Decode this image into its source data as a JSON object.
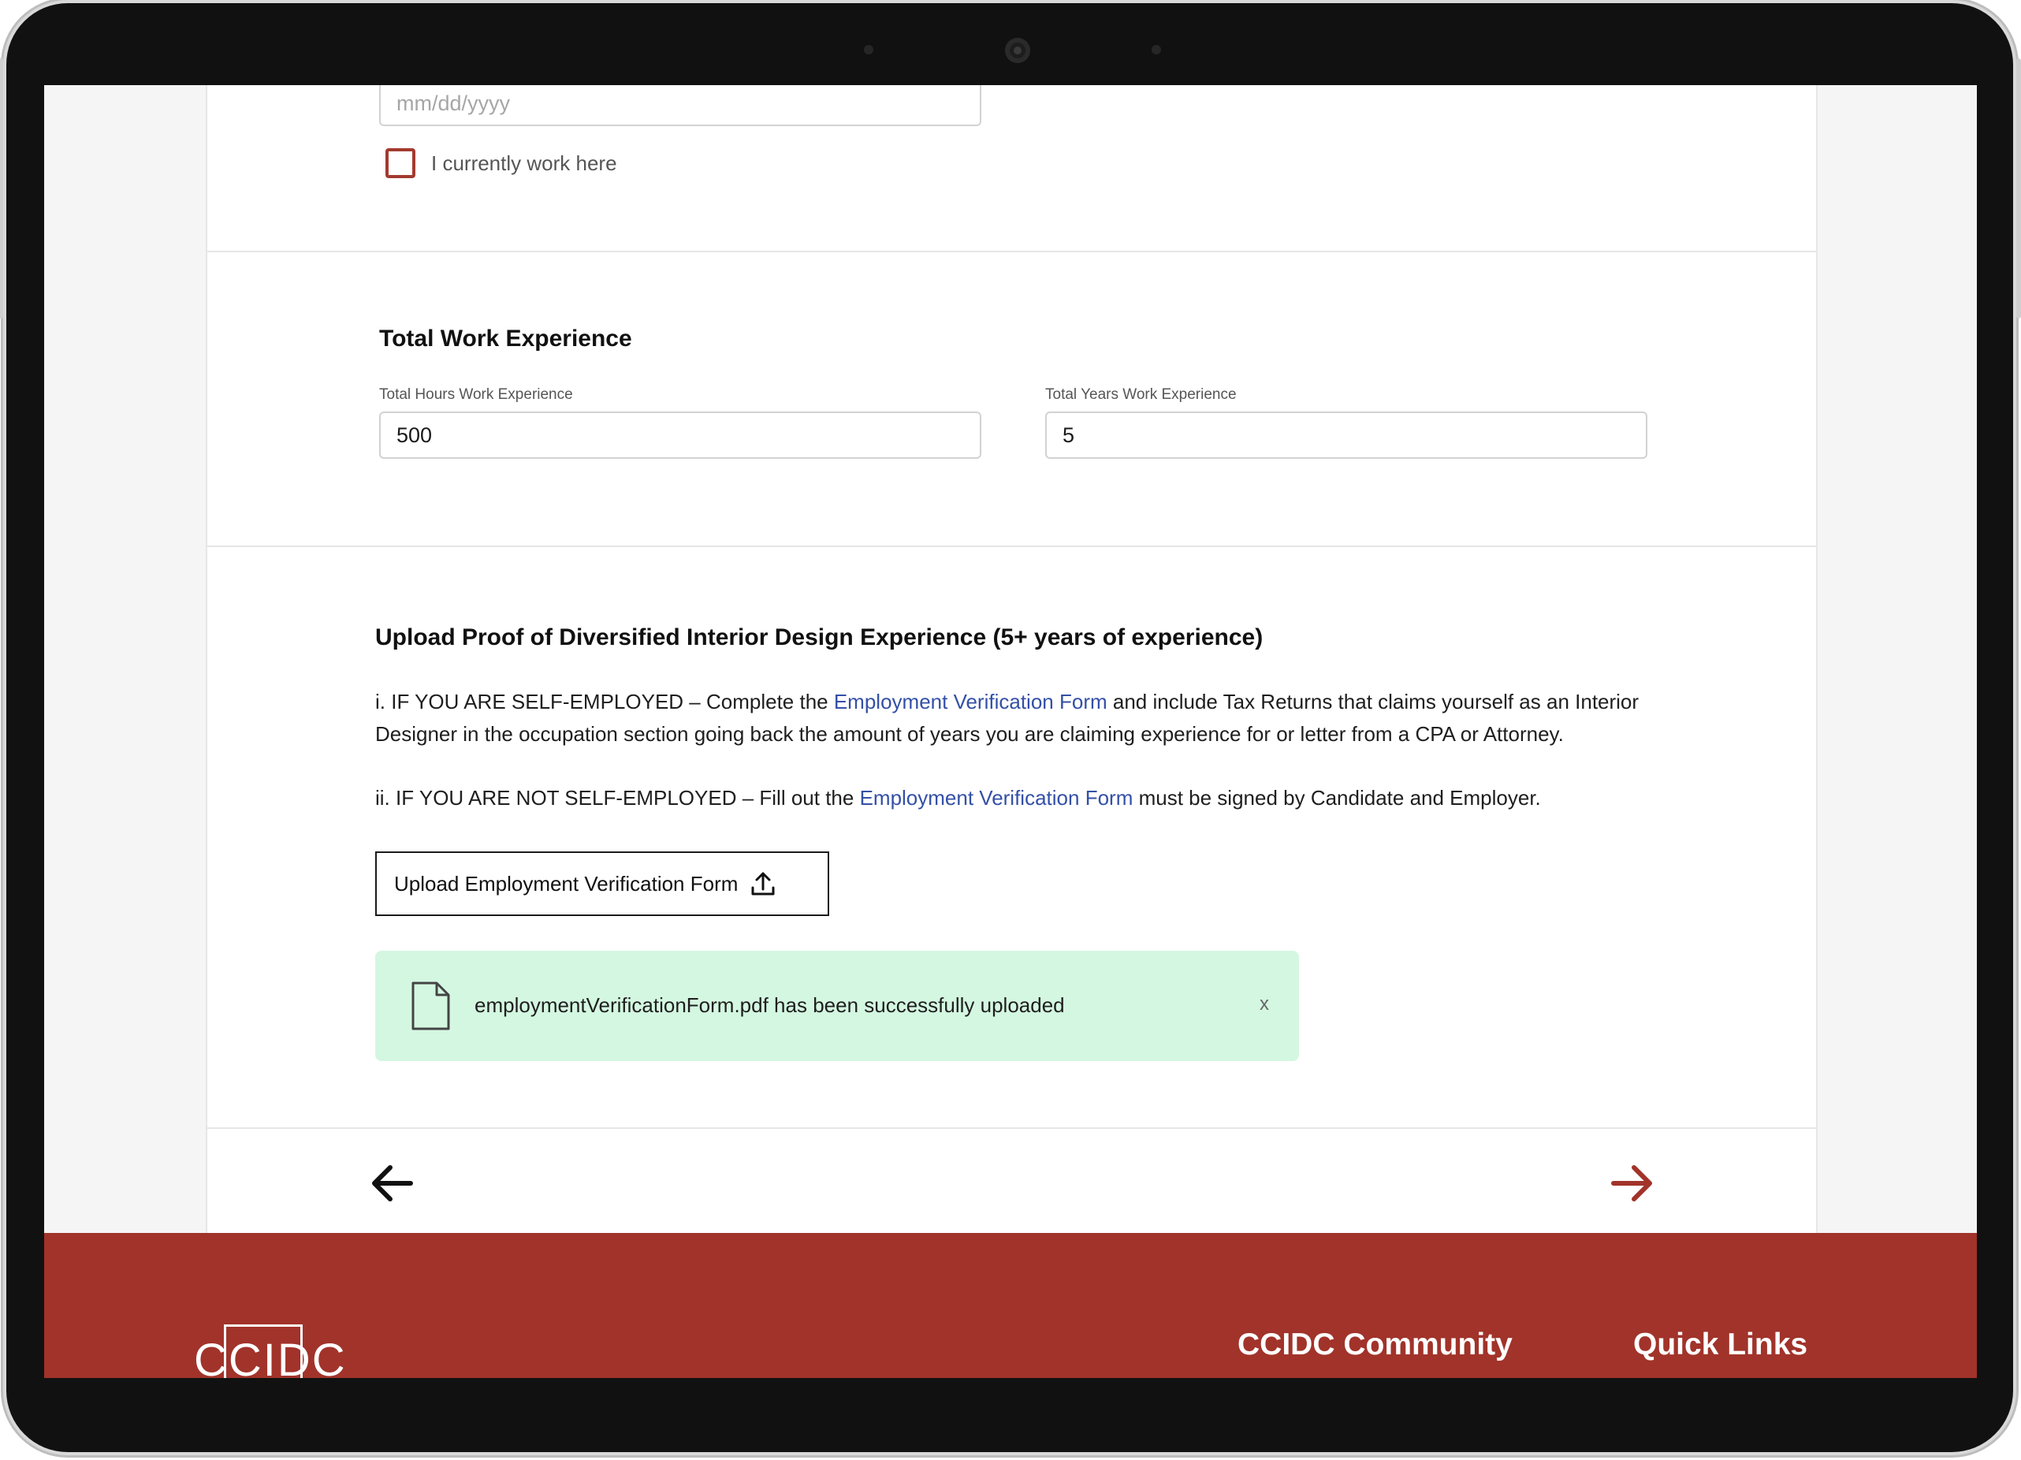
{
  "work": {
    "end_date_placeholder": "mm/dd/yyyy",
    "currently_work_label": "I currently work here"
  },
  "total_experience": {
    "heading": "Total Work Experience",
    "hours_label": "Total Hours Work Experience",
    "hours_value": "500",
    "years_label": "Total Years Work Experience",
    "years_value": "5"
  },
  "upload_section": {
    "heading": "Upload Proof of Diversified Interior Design Experience (5+ years of experience)",
    "para1_before": "i. IF YOU ARE SELF-EMPLOYED – Complete the ",
    "para1_link": "Employment Verification Form",
    "para1_after": " and include Tax Returns that claims yourself as an Interior Designer in the occupation section going back the amount of years you are claiming experience for or letter from a CPA or Attorney.",
    "para2_before": "ii. IF YOU ARE NOT SELF-EMPLOYED – Fill out the ",
    "para2_link": "Employment Verification Form",
    "para2_after": " must be signed by Candidate and Employer.",
    "upload_button_label": "Upload Employment Verification Form",
    "success_message": "employmentVerificationForm.pdf has been successfully uploaded",
    "dismiss_label": "x"
  },
  "footer": {
    "logo_text": "CCIDC",
    "col1_title": "CCIDC Community",
    "col2_title": "Quick Links"
  },
  "colors": {
    "brand_red": "#a1332a",
    "link_blue": "#3450a6",
    "success_bg": "#d4f7e1"
  }
}
